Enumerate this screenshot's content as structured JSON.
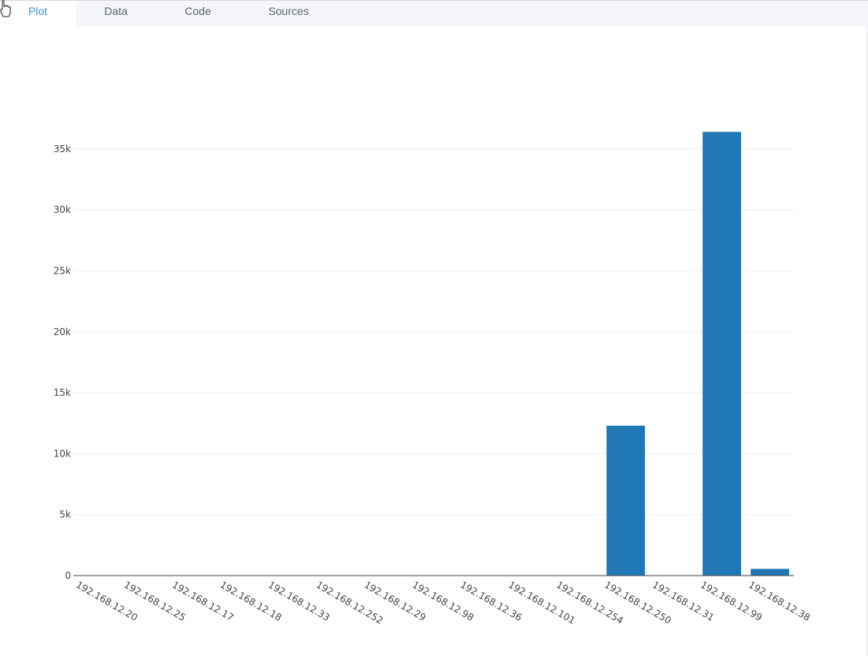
{
  "tabs": {
    "plot": "Plot",
    "data": "Data",
    "code": "Code",
    "sources": "Sources"
  },
  "colors": {
    "bar": "#1f77b4",
    "active_tab": "#3d8fd1",
    "grid": "#eeeeee"
  },
  "icons": {
    "cursor": "hand-pointer-icon"
  },
  "chart_data": {
    "type": "bar",
    "categories": [
      "192.168.12.20",
      "192.168.12.25",
      "192.168.12.17",
      "192.168.12.18",
      "192.168.12.33",
      "192.168.12.252",
      "192.168.12.29",
      "192.168.12.98",
      "192.168.12.36",
      "192.168.12.101",
      "192.168.12.254",
      "192.168.12.250",
      "192.168.12.31",
      "192.168.12.99",
      "192.168.12.38"
    ],
    "values": [
      0,
      0,
      0,
      0,
      0,
      0,
      0,
      0,
      0,
      0,
      0,
      12300,
      0,
      36400,
      550
    ],
    "ylim": [
      0,
      37000
    ],
    "yticks": [
      0,
      5000,
      10000,
      15000,
      20000,
      25000,
      30000,
      35000
    ],
    "ytick_labels": [
      "0",
      "5k",
      "10k",
      "15k",
      "20k",
      "25k",
      "30k",
      "35k"
    ],
    "grid": true,
    "legend": "none"
  }
}
